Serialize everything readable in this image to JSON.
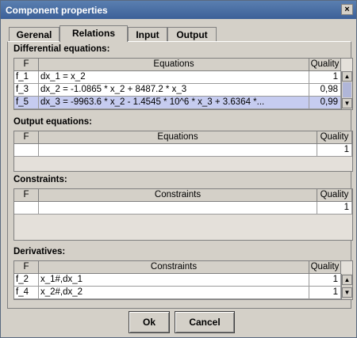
{
  "window": {
    "title": "Component properties",
    "close_glyph": "×"
  },
  "tabs": [
    {
      "label": "Gerenal"
    },
    {
      "label": "Relations"
    },
    {
      "label": "Input"
    },
    {
      "label": "Output"
    }
  ],
  "active_tab": "Relations",
  "differential": {
    "title": "Differential equations:",
    "headers": {
      "f": "F",
      "equations": "Equations",
      "quality": "Quality"
    },
    "rows": [
      {
        "f": "f_1",
        "eq": "dx_1 = x_2",
        "quality": "1"
      },
      {
        "f": "f_3",
        "eq": "dx_2 = -1.0865 * x_2 + 8487.2 * x_3",
        "quality": "0,98"
      },
      {
        "f": "f_5",
        "eq": "dx_3 = -9963.6 * x_2  - 1.4545 * 10^6  * x_3 + 3.6364 *...",
        "quality": "0,99"
      }
    ]
  },
  "output": {
    "title": "Output equations:",
    "headers": {
      "f": "F",
      "equations": "Equations",
      "quality": "Quality"
    },
    "rows": [
      {
        "f": "",
        "eq": "",
        "quality": "1"
      }
    ]
  },
  "constraints": {
    "title": "Constraints:",
    "headers": {
      "f": "F",
      "constraints": "Constraints",
      "quality": "Quality"
    },
    "rows": [
      {
        "f": "",
        "eq": "",
        "quality": "1"
      }
    ]
  },
  "derivatives": {
    "title": "Derivatives:",
    "headers": {
      "f": "F",
      "constraints": "Constraints",
      "quality": "Quality"
    },
    "rows": [
      {
        "f": "f_2",
        "eq": "x_1#,dx_1",
        "quality": "1"
      },
      {
        "f": "f_4",
        "eq": "x_2#,dx_2",
        "quality": "1"
      }
    ]
  },
  "buttons": {
    "ok": "Ok",
    "cancel": "Cancel"
  },
  "icons": {
    "scroll_up": "▲",
    "scroll_down": "▼"
  },
  "colors": {
    "title_bar": "#3c6098",
    "selected_row": "#c6ccf0",
    "dialog_bg": "#d4d0c8"
  }
}
